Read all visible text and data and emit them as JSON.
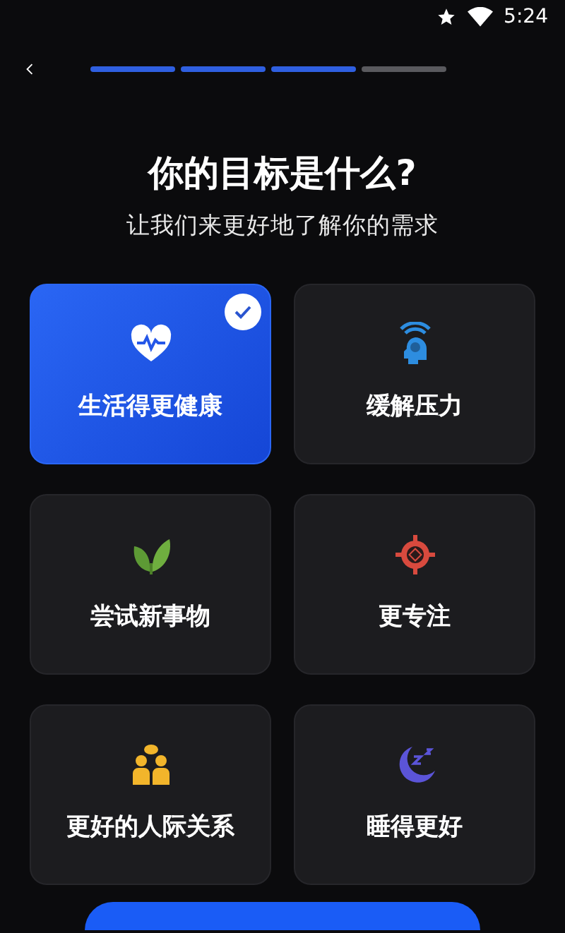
{
  "status_bar": {
    "time": "5:24"
  },
  "progress": [
    {
      "done": true
    },
    {
      "done": true
    },
    {
      "done": true
    },
    {
      "done": false
    }
  ],
  "title": "你的目标是什么?",
  "subtitle": "让我们来更好地了解你的需求",
  "goals": [
    {
      "kind": "heart",
      "label": "生活得更健康",
      "selected": true
    },
    {
      "kind": "head",
      "label": "缓解压力",
      "selected": false
    },
    {
      "kind": "leaf",
      "label": "尝试新事物",
      "selected": false
    },
    {
      "kind": "target",
      "label": "更专注",
      "selected": false
    },
    {
      "kind": "people",
      "label": "更好的人际关系",
      "selected": false
    },
    {
      "kind": "moon",
      "label": "睡得更好",
      "selected": false
    }
  ]
}
